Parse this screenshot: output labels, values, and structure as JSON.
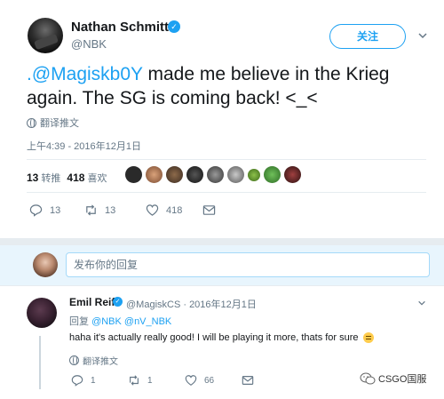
{
  "tweet": {
    "name": "Nathan Schmitt",
    "handle": "@NBK",
    "follow_label": "关注",
    "text_mention": ".@Magiskb0Y",
    "text_rest": " made me believe in the Krieg again. The SG is coming back! <_<",
    "translate_label": "翻译推文",
    "timestamp": "上午4:39 - 2016年12月1日",
    "retweets_count": "13",
    "retweets_label": "转推",
    "likes_count": "418",
    "likes_label": "喜欢",
    "actions": {
      "reply_count": "13",
      "retweet_count": "13",
      "like_count": "418"
    }
  },
  "reply_box": {
    "placeholder": "发布你的回复"
  },
  "reply": {
    "name": "Emil Reif",
    "meta": "@MagiskCS · 2016年12月1日",
    "replying_prefix": "回复 ",
    "replying_mentions": "@NBK @nV_NBK",
    "text": "haha it's actually really good! I will be playing it more, thats for sure",
    "translate_label": "翻译推文",
    "actions": {
      "reply_count": "1",
      "retweet_count": "1",
      "like_count": "66"
    }
  },
  "watermark": {
    "text": "CSGO国服"
  },
  "colors": {
    "accent": "#1da1f2",
    "secondary_text": "#657786",
    "like_red": "#e0245e"
  },
  "icons": [
    "verified-icon",
    "caret-down-icon",
    "globe-icon",
    "reply-icon",
    "retweet-icon",
    "heart-icon",
    "message-icon",
    "emoji-icon",
    "wechat-icon"
  ]
}
